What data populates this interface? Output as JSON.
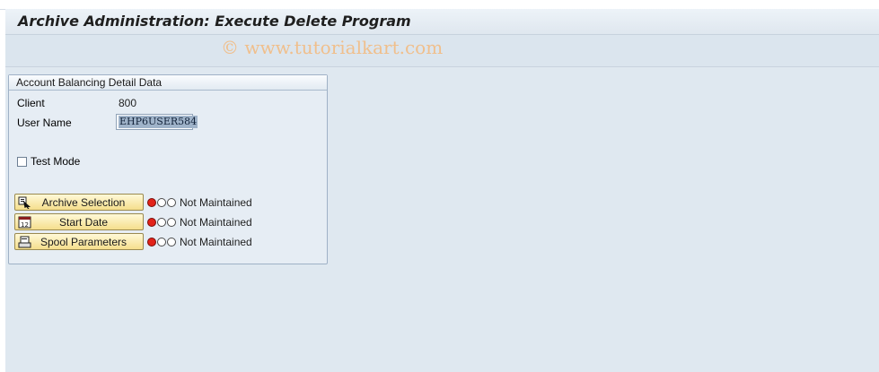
{
  "window": {
    "title": "Archive Administration: Execute Delete Program"
  },
  "watermark": "© www.tutorialkart.com",
  "group": {
    "title": "Account Balancing Detail Data",
    "fields": {
      "client_label": "Client",
      "client_value": "800",
      "user_label": "User Name",
      "user_value": "EHP6USER584",
      "test_mode_label": "Test Mode",
      "test_mode_checked": false
    },
    "actions": [
      {
        "label": "Archive Selection",
        "icon": "variant-select-icon",
        "status": "Not Maintained",
        "light": "red"
      },
      {
        "label": "Start Date",
        "icon": "calendar-icon",
        "status": "Not Maintained",
        "light": "red"
      },
      {
        "label": "Spool Parameters",
        "icon": "printer-icon",
        "status": "Not Maintained",
        "light": "red"
      }
    ]
  },
  "colors": {
    "button_fill": "#f5de8c",
    "status_red": "#e2231a",
    "frame": "#dfe8f0"
  }
}
